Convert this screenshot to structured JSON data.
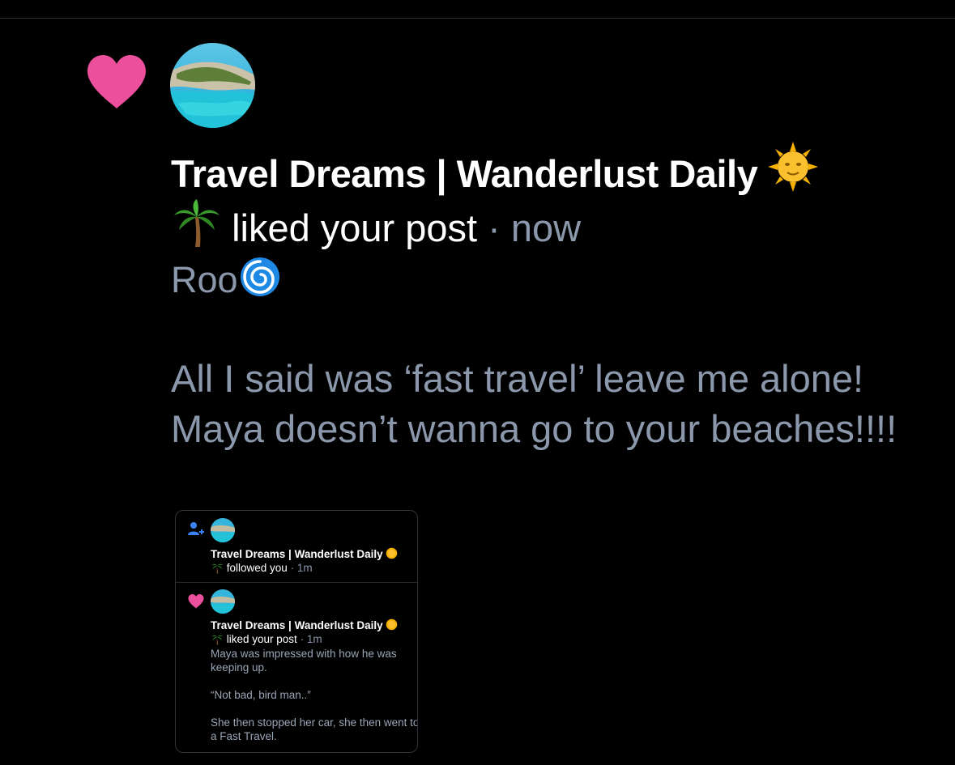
{
  "notification": {
    "type_icon": "heart-icon",
    "account_name": "Travel Dreams | Wanderlust Daily",
    "action": "liked your post",
    "separator": "·",
    "time": "now",
    "post_author": "Roo",
    "post_text": "All I said was ‘fast travel’ leave me alone! Maya doesn’t wanna go to your beaches!!!!"
  },
  "embedded_screenshot": {
    "items": [
      {
        "type_icon": "follow-user-icon",
        "account_name": "Travel Dreams | Wanderlust Daily",
        "action": "followed you",
        "separator": "·",
        "time": "1m"
      },
      {
        "type_icon": "heart-icon",
        "account_name": "Travel Dreams | Wanderlust Daily",
        "action": "liked your post",
        "separator": "·",
        "time": "1m",
        "post_paragraphs": [
          "Maya was impressed with how he was keeping up.",
          "“Not bad, bird man..”",
          "She then stopped her car, she then went to a Fast Travel."
        ]
      }
    ]
  },
  "colors": {
    "background": "#000000",
    "heart": "#ec4f9c",
    "muted_text": "#8b98ab",
    "follow_icon": "#3b82f6"
  }
}
